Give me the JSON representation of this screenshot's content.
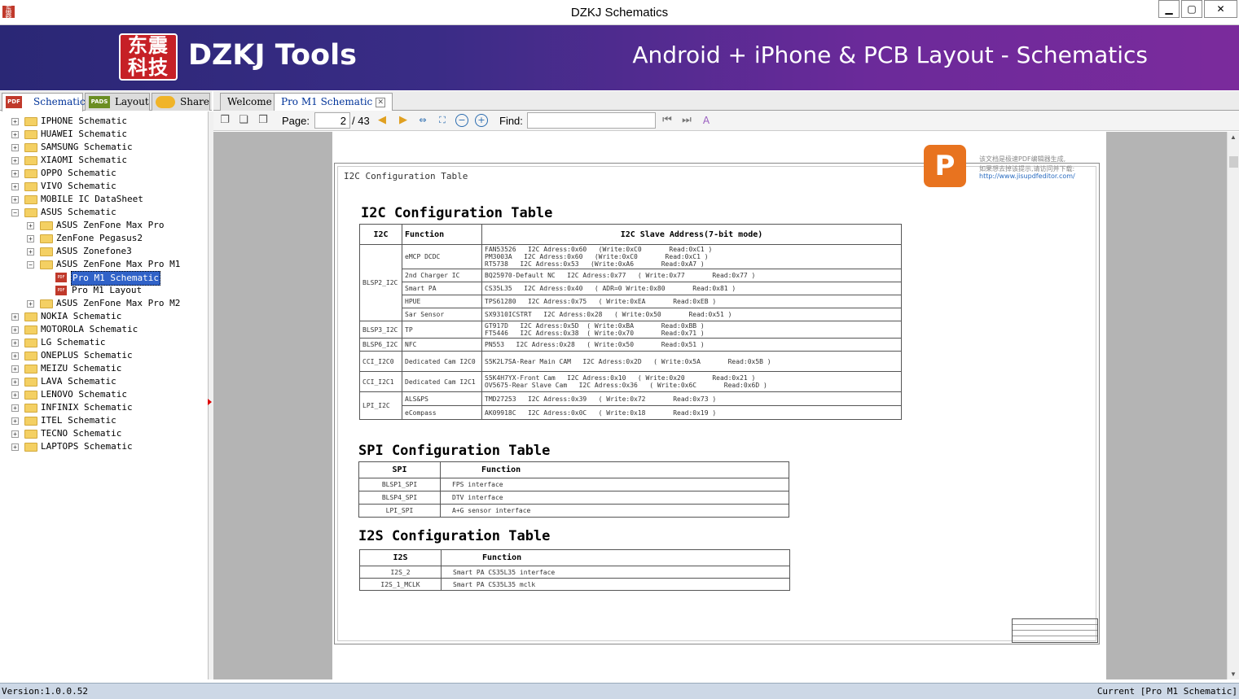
{
  "window": {
    "title": "DZKJ Schematics",
    "minimize": "▁",
    "maximize": "▢",
    "close": "✕",
    "app_icon": "东震科技"
  },
  "banner": {
    "logo_text": "东震科技",
    "brand": "DZKJ Tools",
    "tagline": "Android + iPhone & PCB Layout - Schematics"
  },
  "left_tabs": [
    {
      "label": "Schematic",
      "icon": "PDF"
    },
    {
      "label": "Layout",
      "icon": "PADS"
    },
    {
      "label": "Share",
      "icon": "cloud-icon"
    }
  ],
  "tree": [
    {
      "label": "IPHONE Schematic"
    },
    {
      "label": "HUAWEI Schematic"
    },
    {
      "label": "SAMSUNG Schematic"
    },
    {
      "label": "XIAOMI Schematic"
    },
    {
      "label": "OPPO Schematic"
    },
    {
      "label": "VIVO Schematic"
    },
    {
      "label": "MOBILE IC DataSheet"
    },
    {
      "label": "ASUS Schematic"
    },
    {
      "label": "ASUS ZenFone Max Pro"
    },
    {
      "label": "ZenFone Pegasus2"
    },
    {
      "label": "ASUS Zonefone3"
    },
    {
      "label": "ASUS ZenFone Max Pro M1"
    },
    {
      "label": "Pro M1 Schematic"
    },
    {
      "label": "Pro M1 Layout"
    },
    {
      "label": "ASUS ZenFone Max Pro M2"
    },
    {
      "label": "NOKIA Schematic"
    },
    {
      "label": "MOTOROLA Schematic"
    },
    {
      "label": "LG Schematic"
    },
    {
      "label": "ONEPLUS Schematic"
    },
    {
      "label": "MEIZU Schematic"
    },
    {
      "label": "LAVA Schematic"
    },
    {
      "label": "LENOVO Schematic"
    },
    {
      "label": "INFINIX Schematic"
    },
    {
      "label": "ITEL Schematic"
    },
    {
      "label": "TECNO Schematic"
    },
    {
      "label": "LAPTOPS Schematic"
    }
  ],
  "doc_tabs": [
    {
      "label": "Welcome"
    },
    {
      "label": "Pro M1 Schematic"
    }
  ],
  "toolbar": {
    "page_label": "Page:",
    "page_value": "2",
    "page_total": "/ 43",
    "find_label": "Find:",
    "find_value": ""
  },
  "pdf": {
    "sheet_title": "I2C Configuration Table",
    "watermark_line1": "该文档是极速PDF编辑器生成,",
    "watermark_line2": "如果想去掉该提示,请访问并下载:",
    "watermark_link": "http://www.jisupdfeditor.com/",
    "i2c": {
      "heading": "I2C Configuration Table",
      "headers": [
        "I2C",
        "Function",
        "I2C Slave Address(7-bit mode)"
      ],
      "rows": [
        {
          "bus": "BLSP2_I2C",
          "func": "eMCP DCDC",
          "addr": "FAN53526   I2C Adress:0x60   (Write:0xC0       Read:0xC1 )\nPM3003A   I2C Adress:0x60   (Write:0xC0       Read:0xC1 )\nRT5738   I2C Adress:0x53   (Write:0xA6       Read:0xA7 )"
        },
        {
          "bus": "",
          "func": "2nd Charger IC",
          "addr": "BQ25970-Default NC   I2C Adress:0x77   ( Write:0x77       Read:0x77 )"
        },
        {
          "bus": "",
          "func": "Smart PA",
          "addr": "CS35L35   I2C Adress:0x40   ( ADR=0 Write:0x80       Read:0x81 )"
        },
        {
          "bus": "",
          "func": "HPUE",
          "addr": "TPS61280   I2C Adress:0x75   ( Write:0xEA       Read:0xEB )"
        },
        {
          "bus": "",
          "func": "Sar Sensor",
          "addr": "SX9310ICSTRT   I2C Adress:0x28   ( Write:0x50       Read:0x51 )"
        },
        {
          "bus": "BLSP3_I2C",
          "func": "TP",
          "addr": "GT917D   I2C Adress:0x5D  ( Write:0xBA       Read:0xBB )\nFT5446   I2C Adress:0x38  ( Write:0x70       Read:0x71 )"
        },
        {
          "bus": "BLSP6_I2C",
          "func": "NFC",
          "addr": "PN553   I2C Adress:0x28   ( Write:0x50       Read:0x51 )"
        },
        {
          "bus": "CCI_I2C0",
          "func": "Dedicated Cam I2C0",
          "addr": "S5K2L7SA-Rear Main CAM   I2C Adress:0x2D   ( Write:0x5A       Read:0x5B )"
        },
        {
          "bus": "CCI_I2C1",
          "func": "Dedicated Cam I2C1",
          "addr": "S5K4H7YX-Front Cam   I2C Adress:0x10   ( Write:0x20       Read:0x21 )\nOV5675-Rear Slave Cam   I2C Adress:0x36   ( Write:0x6C       Read:0x6D )"
        },
        {
          "bus": "LPI_I2C",
          "func": "ALS&PS",
          "addr": "TMD27253   I2C Adress:0x39   ( Write:0x72       Read:0x73 )"
        },
        {
          "bus": "",
          "func": "eCompass",
          "addr": "AK09918C   I2C Adress:0x0C   ( Write:0x18       Read:0x19 )"
        }
      ]
    },
    "spi": {
      "heading": "SPI Configuration Table",
      "headers": [
        "SPI",
        "Function"
      ],
      "rows": [
        [
          "BLSP1_SPI",
          "FPS interface"
        ],
        [
          "BLSP4_SPI",
          "DTV interface"
        ],
        [
          "LPI_SPI",
          "A+G sensor interface"
        ]
      ]
    },
    "i2s": {
      "heading": "I2S Configuration Table",
      "headers": [
        "I2S",
        "Function"
      ],
      "rows": [
        [
          "I2S_2",
          "Smart PA CS35L35 interface"
        ],
        [
          "I2S_1_MCLK",
          "Smart PA CS35L35 mclk"
        ]
      ]
    }
  },
  "status": {
    "version": "Version:1.0.0.52",
    "current": "Current [Pro M1 Schematic]"
  }
}
